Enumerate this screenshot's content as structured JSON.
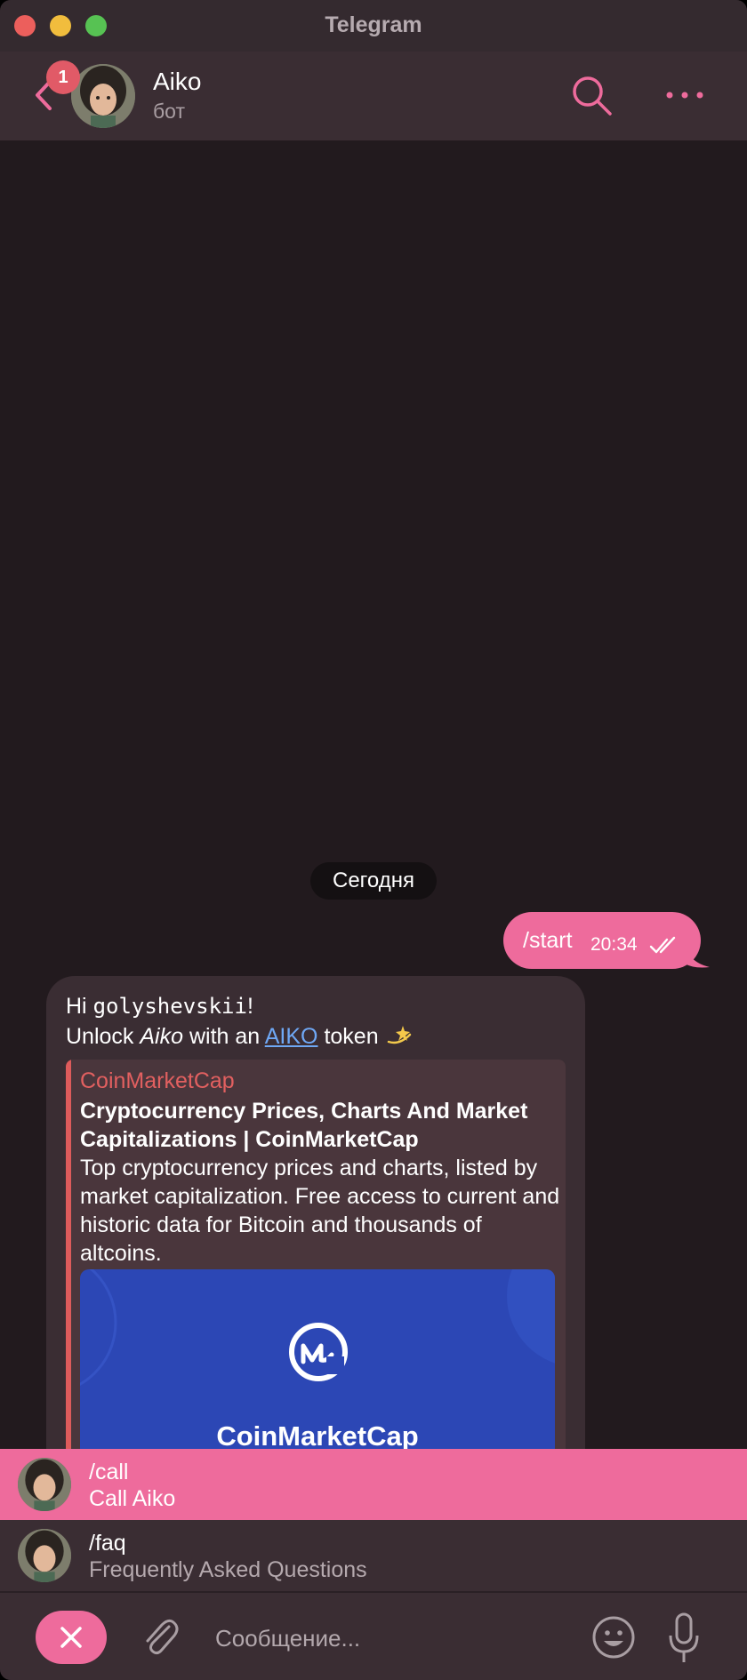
{
  "window": {
    "title": "Telegram"
  },
  "header": {
    "unread_badge": "1",
    "name": "Aiko",
    "subtitle": "бот"
  },
  "chat": {
    "date_separator": "Сегодня",
    "outgoing": {
      "text": "/start",
      "time": "20:34"
    },
    "incoming": {
      "greeting": "Hi ",
      "username": "golyshevskii",
      "greeting_end": "!",
      "unlock_prefix": "Unlock ",
      "unlock_name": "Aiko",
      "unlock_mid": " with an ",
      "unlock_link": "AIKO",
      "unlock_suffix": " token",
      "preview": {
        "site": "CoinMarketCap",
        "title": "Cryptocurrency Prices, Charts And Market Capitalizations | CoinMarketCap",
        "description": "Top cryptocurrency prices and charts, listed by market capitalization. Free access to current and historic data for Bitcoin and thousands of altcoins.",
        "image_brand": "CoinMarketCap"
      }
    }
  },
  "commands": [
    {
      "command": "/call",
      "description": "Call Aiko"
    },
    {
      "command": "/faq",
      "description": "Frequently Asked Questions"
    }
  ],
  "input": {
    "placeholder": "Сообщение..."
  },
  "colors": {
    "accent": "#ee6b9c",
    "background": "#221a1e",
    "panel": "#3a2d33",
    "link": "#6fa8f5"
  }
}
